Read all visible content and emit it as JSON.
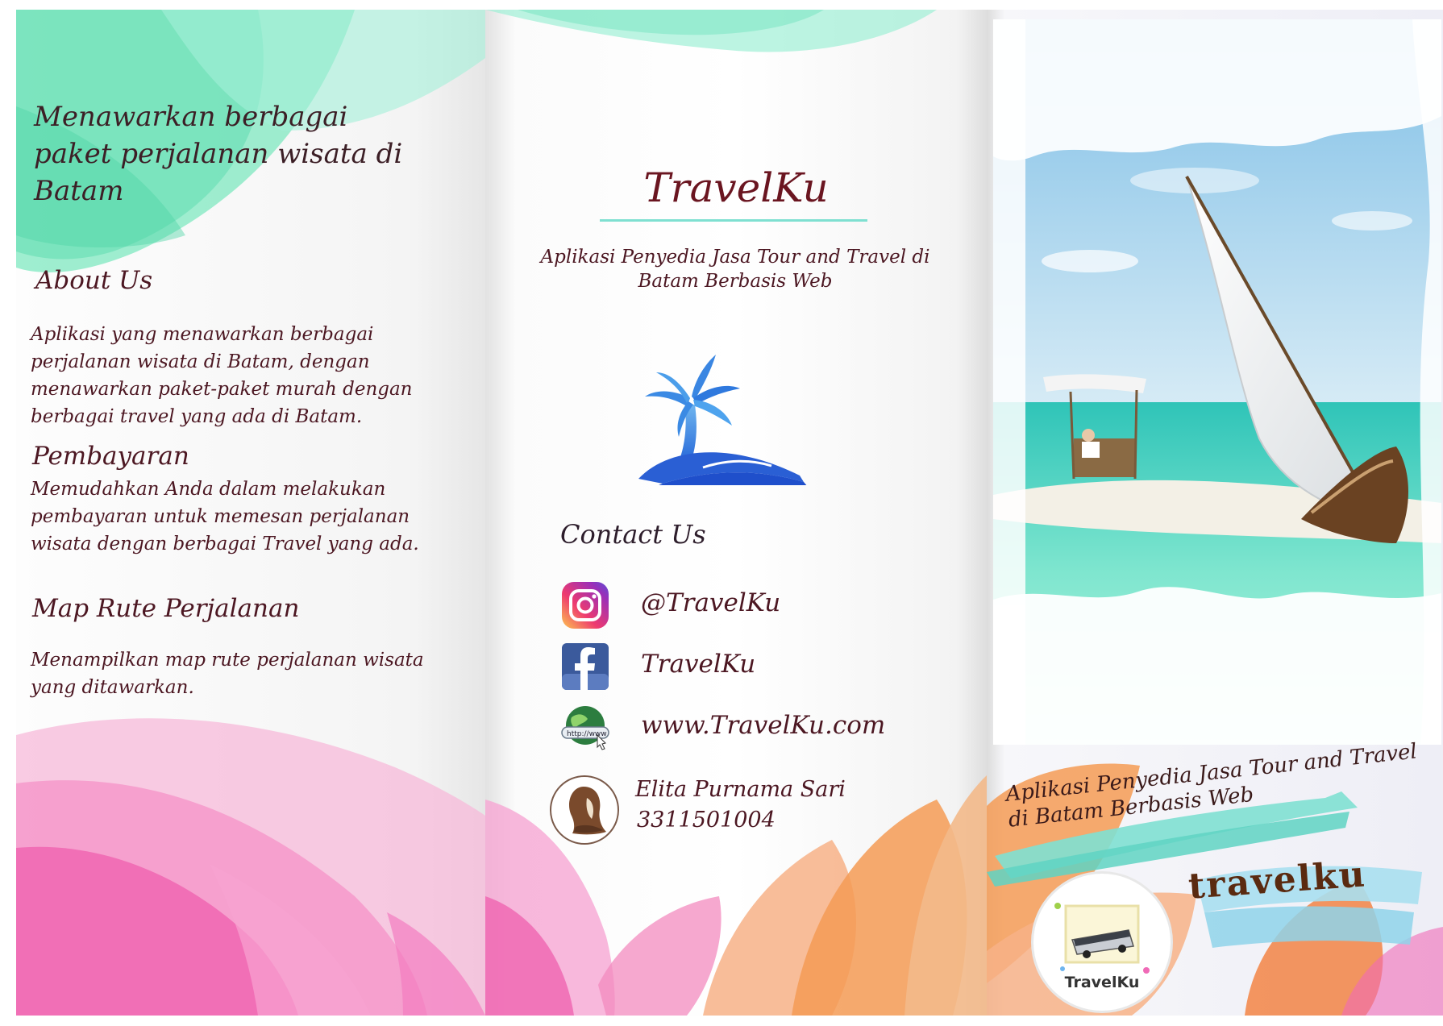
{
  "left_panel": {
    "tagline": "Menawarkan  berbagai paket perjalanan wisata di Batam",
    "about_title": "About Us",
    "about_body": "Aplikasi yang menawarkan berbagai perjalanan wisata di Batam, dengan menawarkan paket-paket murah dengan berbagai travel yang ada di Batam.",
    "payment_title": "Pembayaran",
    "payment_body": "Memudahkan Anda dalam melakukan pembayaran untuk memesan perjalanan wisata dengan berbagai Travel yang ada.",
    "map_title": "Map Rute Perjalanan",
    "map_body": "Menampilkan map rute perjalanan wisata yang ditawarkan."
  },
  "middle_panel": {
    "brand": "TravelKu",
    "subtitle": "Aplikasi Penyedia Jasa Tour and Travel di Batam Berbasis Web",
    "contact_title": "Contact Us",
    "contacts": [
      {
        "icon": "instagram-icon",
        "text": "@TravelKu"
      },
      {
        "icon": "facebook-icon",
        "text": "TravelKu"
      },
      {
        "icon": "globe-icon",
        "text": "www.TravelKu.com"
      }
    ],
    "author_name": "Elita Purnama Sari",
    "author_id": "3311501004"
  },
  "right_panel": {
    "banner_text": "Aplikasi Penyedia Jasa Tour and Travel di Batam Berbasis Web",
    "logo_wordmark": "travelku",
    "logo_badge_label": "TravelKu"
  },
  "colors": {
    "text_brown": "#4c1722",
    "accent_teal": "#7fe0d1",
    "accent_pink": "#f06ab7",
    "accent_orange": "#f39a4c",
    "accent_mint": "#6fe3b8"
  }
}
